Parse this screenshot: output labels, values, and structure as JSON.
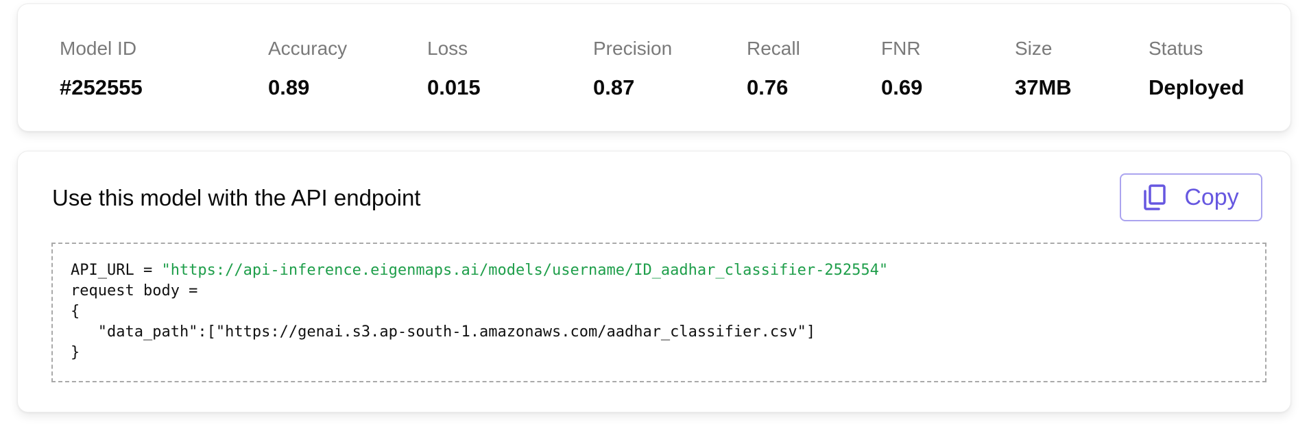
{
  "metrics": [
    {
      "label": "Model ID",
      "value": "#252555"
    },
    {
      "label": "Accuracy",
      "value": "0.89"
    },
    {
      "label": "Loss",
      "value": "0.015"
    },
    {
      "label": "Precision",
      "value": "0.87"
    },
    {
      "label": "Recall",
      "value": "0.76"
    },
    {
      "label": "FNR",
      "value": "0.69"
    },
    {
      "label": "Size",
      "value": "37MB"
    },
    {
      "label": "Status",
      "value": "Deployed"
    }
  ],
  "api": {
    "title": "Use this model with the API endpoint",
    "copy_label": "Copy",
    "copy_icon": "copy-icon",
    "accent_color": "#6657e0",
    "code": {
      "line1_prefix": "API_URL = ",
      "line1_string": "\"https://api-inference.eigenmaps.ai/models/username/ID_aadhar_classifier-252554\"",
      "line2": "request body =",
      "line3": "{",
      "line4": "   \"data_path\":[\"https://genai.s3.ap-south-1.amazonaws.com/aadhar_classifier.csv\"]",
      "line5": "}"
    }
  }
}
